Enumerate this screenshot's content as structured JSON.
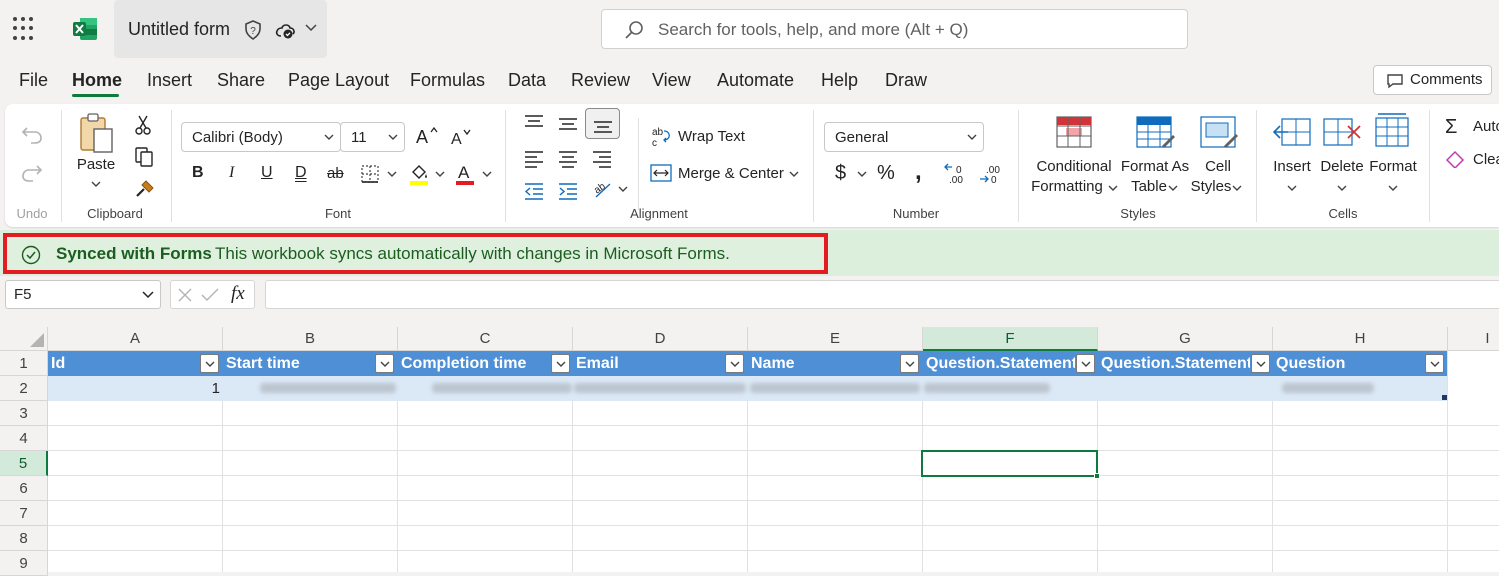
{
  "app": {
    "title": "Untitled form",
    "search_placeholder": "Search for tools, help, and more (Alt + Q)"
  },
  "menu": {
    "tabs": [
      "File",
      "Home",
      "Insert",
      "Share",
      "Page Layout",
      "Formulas",
      "Data",
      "Review",
      "View",
      "Automate",
      "Help",
      "Draw"
    ],
    "active_tab": "Home",
    "comments_label": "Comments"
  },
  "ribbon": {
    "undo": {
      "label": "Undo"
    },
    "clipboard": {
      "label": "Clipboard",
      "paste_label": "Paste"
    },
    "font": {
      "label": "Font",
      "font_name": "Calibri (Body)",
      "font_size": "11"
    },
    "alignment": {
      "label": "Alignment",
      "wrap_text": "Wrap Text",
      "merge_center": "Merge & Center"
    },
    "number": {
      "label": "Number",
      "format": "General"
    },
    "styles": {
      "label": "Styles",
      "conditional_1": "Conditional",
      "conditional_2": "Formatting",
      "format_table_1": "Format As",
      "format_table_2": "Table",
      "cell_styles_1": "Cell",
      "cell_styles_2": "Styles"
    },
    "cells": {
      "label": "Cells",
      "insert": "Insert",
      "delete": "Delete",
      "format": "Format"
    },
    "editing": {
      "autosum": "Auto",
      "clear": "Clea"
    }
  },
  "banner": {
    "title": "Synced with Forms",
    "message": "This workbook syncs automatically with changes in Microsoft Forms."
  },
  "formula": {
    "name_box": "F5",
    "fx": "fx"
  },
  "sheet": {
    "columns": [
      "A",
      "B",
      "C",
      "D",
      "E",
      "F",
      "G",
      "H",
      "I"
    ],
    "selected_column": "F",
    "rows": [
      "1",
      "2",
      "3",
      "4",
      "5",
      "6",
      "7",
      "8",
      "9"
    ],
    "selected_row": "5",
    "table_headers": [
      "Id",
      "Start time",
      "Completion time",
      "Email",
      "Name",
      "Question.Statement",
      "Question.Statement",
      "Question"
    ],
    "row2_id": "1"
  },
  "colors": {
    "accent": "#0e7a3e",
    "table_header": "#4f8fd6",
    "banner_bg": "#dcefdc",
    "highlight_border": "#e31c23"
  }
}
